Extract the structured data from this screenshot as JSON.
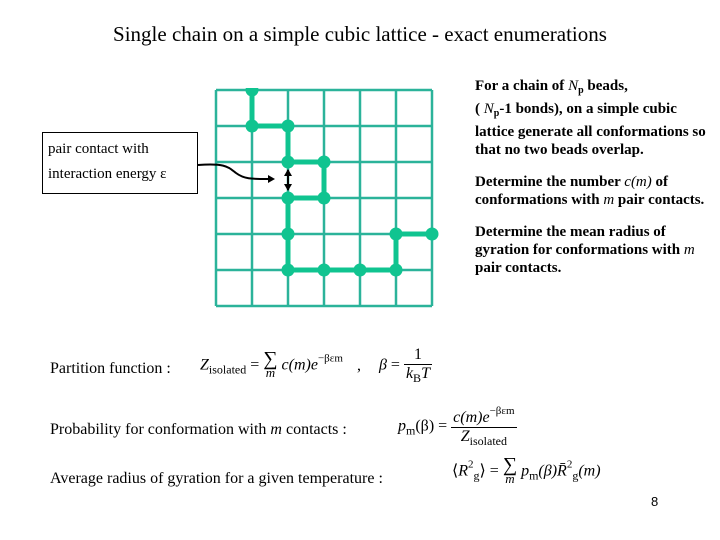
{
  "slide": {
    "title": "Single chain on a simple cubic lattice - exact enumerations",
    "page_number": "8"
  },
  "diagram": {
    "grid_color": "#2bb39a",
    "chain_color": "#10c490",
    "grid_size": 6,
    "chain_beads": [
      [
        1,
        0
      ],
      [
        1,
        1
      ],
      [
        2,
        1
      ],
      [
        2,
        2
      ],
      [
        3,
        2
      ],
      [
        3,
        3
      ],
      [
        2,
        3
      ],
      [
        2,
        4
      ],
      [
        2,
        5
      ],
      [
        3,
        5
      ],
      [
        4,
        5
      ],
      [
        5,
        5
      ],
      [
        5,
        4
      ],
      [
        6,
        4
      ]
    ],
    "contact_pair": [
      [
        2,
        2
      ],
      [
        2,
        3
      ]
    ],
    "callout": {
      "line1": "pair contact with",
      "line2": "interaction energy ε"
    }
  },
  "right_text": {
    "para1": {
      "a": "For a chain of ",
      "np": "N",
      "np_sub": "p",
      "b": " beads,",
      "c": "( ",
      "d": "-1 bonds), on a simple cubic lattice generate all conformations so that no two beads overlap."
    },
    "para2": {
      "a": "Determine the number ",
      "cm": "c(m)",
      "b": " of conformations with ",
      "m": "m",
      "c": " pair contacts."
    },
    "para3": {
      "a": "Determine the mean radius of gyration for conformations with ",
      "m": "m",
      "b": " pair contacts."
    }
  },
  "equations": {
    "partition": {
      "label": "Partition function :",
      "lhs": "Z",
      "lhs_sub": "isolated",
      "eq": " = ",
      "sum_index": "m",
      "term": "c(m)e",
      "exp": "−βεm",
      "comma": ",",
      "beta": "β",
      "num": "1",
      "den_k": "k",
      "den_sub": "B",
      "den_T": "T"
    },
    "probability": {
      "label_a": "Probability for conformation with ",
      "label_m": "m",
      "label_b": " contacts :",
      "lhs": "p",
      "lhs_sub": "m",
      "lhs_arg": "(β) = ",
      "num": "c(m)e",
      "num_exp": "−βεm",
      "den": "Z",
      "den_sub": "isolated"
    },
    "radius": {
      "label": "Average radius of gyration for a given temperature :",
      "lhs_open": "⟨",
      "R": "R",
      "sup": "2",
      "sub": "g",
      "lhs_close": "⟩",
      "eq": " = ",
      "sum_index": "m",
      "p": "p",
      "p_sub": "m",
      "arg": "(β)",
      "Rbar": "R̄",
      "tail": "(m)"
    }
  }
}
